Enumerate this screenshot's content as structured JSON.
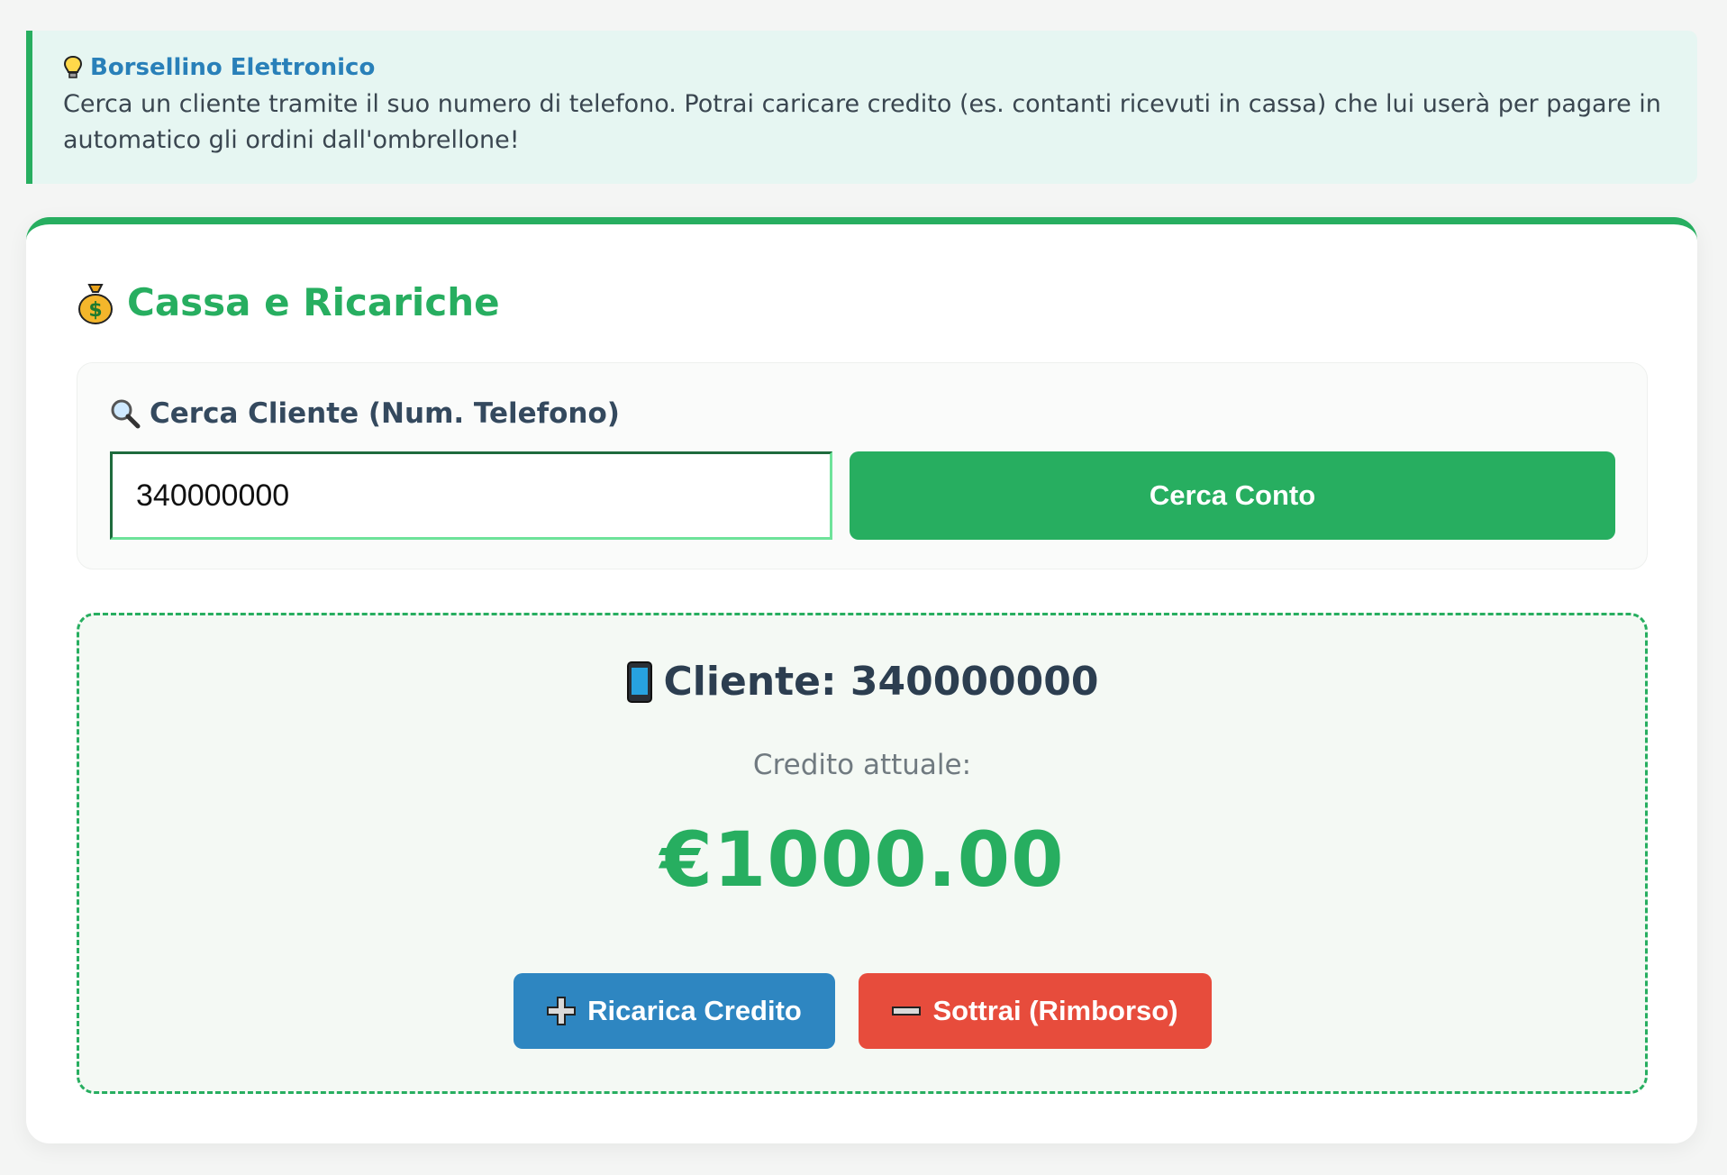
{
  "info": {
    "icon": "lightbulb-icon",
    "title": "Borsellino Elettronico",
    "text": "Cerca un cliente tramite il suo numero di telefono. Potrai caricare credito (es. contanti ricevuti in cassa) che lui userà per pagare in automatico gli ordini dall'ombrellone!"
  },
  "card": {
    "icon": "money-bag-icon",
    "title": "Cassa e Ricariche"
  },
  "search": {
    "icon": "magnifier-icon",
    "label": "Cerca Cliente (Num. Telefono)",
    "value": "340000000",
    "button_label": "Cerca Conto"
  },
  "client": {
    "icon": "mobile-phone-icon",
    "title": "Cliente: 340000000",
    "credit_label": "Credito attuale:",
    "credit_value": "€1000.00",
    "recharge_label": "Ricarica Credito",
    "recharge_icon": "plus-icon",
    "refund_label": "Sottrai (Rimborso)",
    "refund_icon": "minus-icon"
  },
  "colors": {
    "accent": "#27ae60",
    "info_blue": "#2980b9",
    "recharge_blue": "#2e86c1",
    "refund_red": "#e74c3c"
  }
}
